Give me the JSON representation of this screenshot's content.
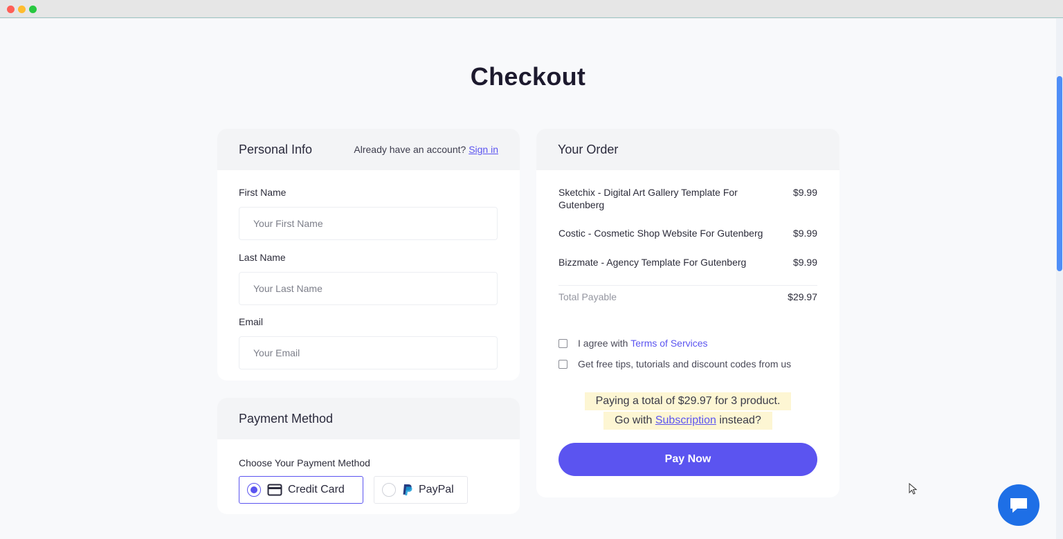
{
  "page": {
    "title": "Checkout"
  },
  "personal_info": {
    "title": "Personal Info",
    "account_prompt": "Already have an account?",
    "sign_in_label": "Sign in",
    "fields": [
      {
        "label": "First Name",
        "placeholder": "Your First Name",
        "value": ""
      },
      {
        "label": "Last Name",
        "placeholder": "Your Last Name",
        "value": ""
      },
      {
        "label": "Email",
        "placeholder": "Your Email",
        "value": ""
      }
    ]
  },
  "payment_method": {
    "title": "Payment Method",
    "choose_label": "Choose Your Payment Method",
    "options": [
      {
        "label": "Credit Card",
        "icon": "credit-card-icon",
        "selected": true
      },
      {
        "label": "PayPal",
        "icon": "paypal-icon",
        "selected": false
      }
    ]
  },
  "order": {
    "title": "Your Order",
    "items": [
      {
        "name": "Sketchix - Digital Art Gallery Template For Gutenberg",
        "price": "$9.99"
      },
      {
        "name": "Costic - Cosmetic Shop Website For Gutenberg",
        "price": "$9.99"
      },
      {
        "name": "Bizzmate - Agency Template For Gutenberg",
        "price": "$9.99"
      }
    ],
    "total_label": "Total Payable",
    "total_value": "$29.97",
    "agree_prefix": "I agree with",
    "terms_label": "Terms of Services",
    "tips_label": "Get free tips, tutorials and discount codes from us",
    "notice_line1": "Paying a total of $29.97 for 3 product.",
    "notice_prefix": "Go with",
    "subscription_label": "Subscription",
    "notice_suffix": "instead?",
    "pay_button": "Pay Now"
  },
  "colors": {
    "accent": "#5b54f0",
    "chat": "#1e6fe6",
    "highlight": "#fdf6d3"
  },
  "chat": {
    "icon": "chat-bubble-icon"
  }
}
